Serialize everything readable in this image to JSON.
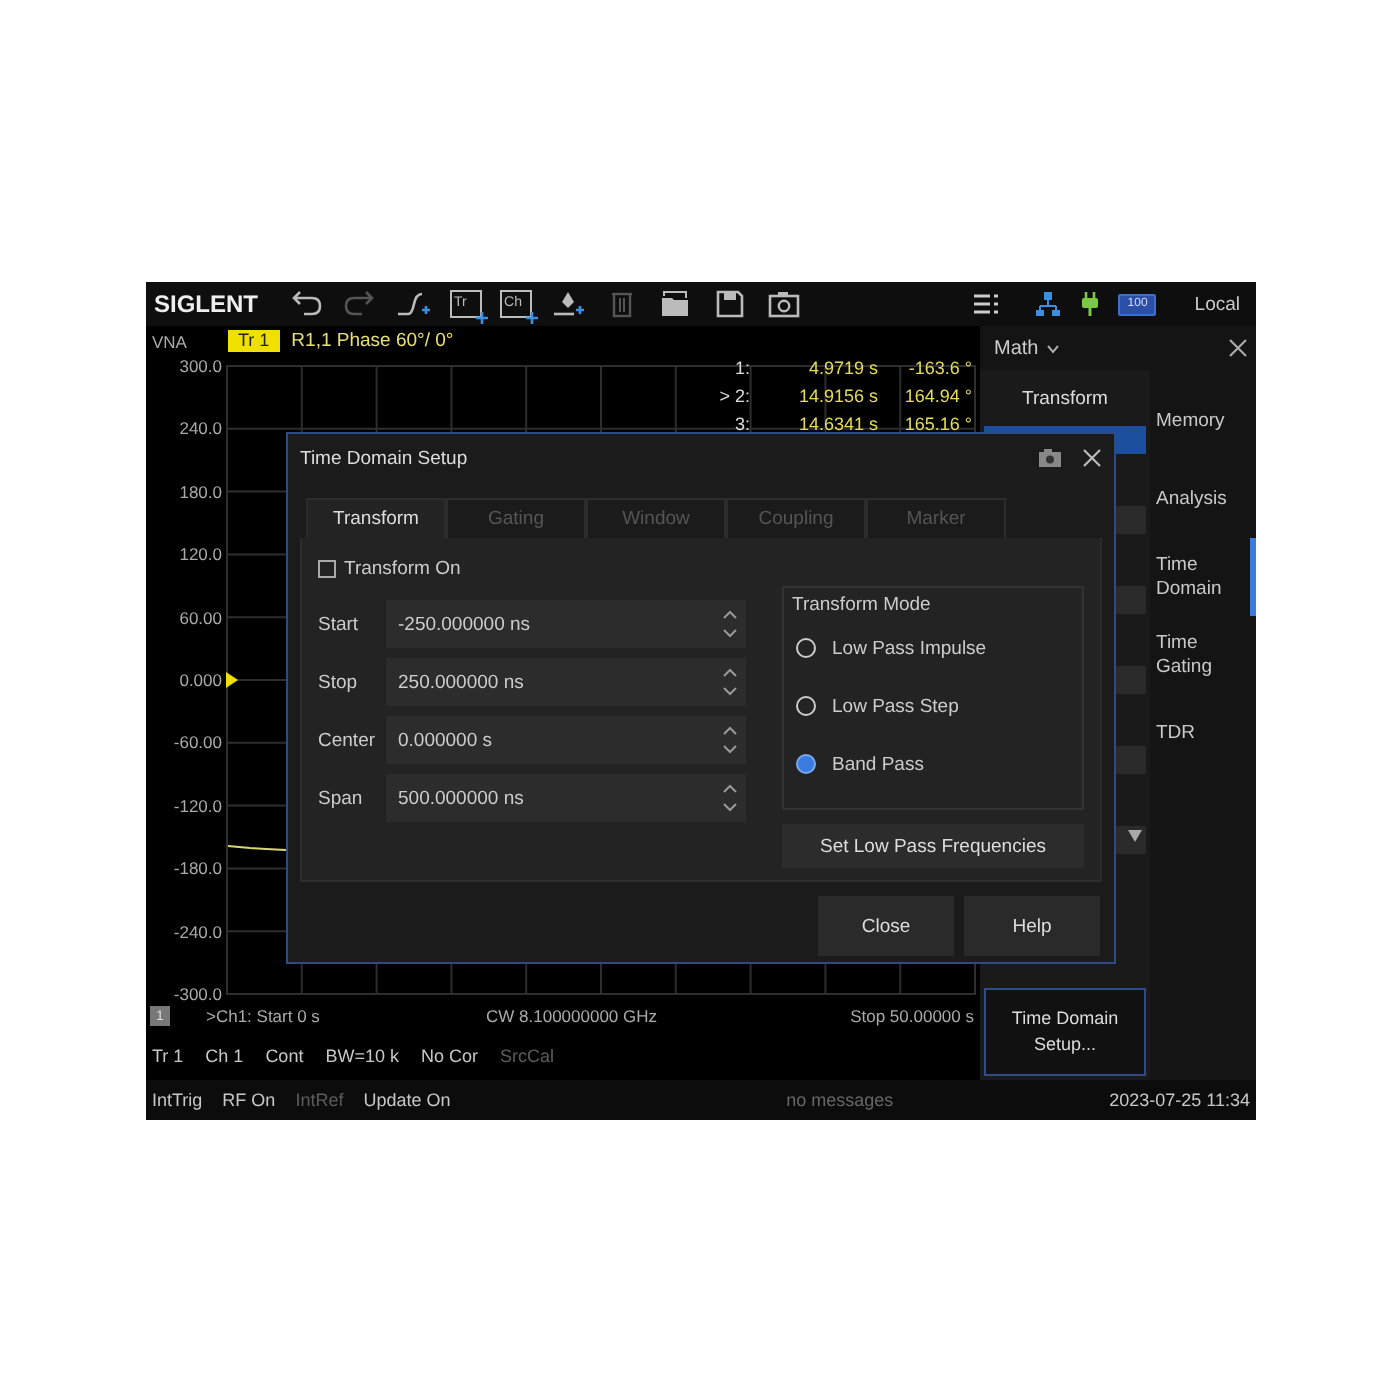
{
  "toolbar": {
    "logo": "SIGLENT",
    "tools": [
      {
        "kind": "undo",
        "disabled": false
      },
      {
        "kind": "redo",
        "disabled": true
      },
      {
        "kind": "step",
        "disabled": false
      },
      {
        "kind": "add_trace",
        "label": "Tr",
        "disabled": false
      },
      {
        "kind": "add_channel",
        "label": "Ch",
        "disabled": false
      },
      {
        "kind": "marker",
        "disabled": false
      },
      {
        "kind": "delete",
        "disabled": true
      },
      {
        "kind": "open",
        "disabled": false
      },
      {
        "kind": "save",
        "disabled": false
      },
      {
        "kind": "camera",
        "disabled": false
      }
    ],
    "battery": "100",
    "mode": "Local"
  },
  "chart": {
    "instrument": "VNA",
    "trace_badge": "Tr 1",
    "trace_label": "R1,1 Phase 60°/ 0°",
    "y_labels": [
      "300.0",
      "240.0",
      "180.0",
      "120.0",
      "60.00",
      "0.000",
      "-60.00",
      "-120.0",
      "-180.0",
      "-240.0",
      "-300.0"
    ],
    "markers": [
      {
        "label": "1:",
        "x": "4.9719 s",
        "y": "-163.6 °"
      },
      {
        "label": "> 2:",
        "x": "14.9156 s",
        "y": "164.94 °"
      },
      {
        "label": "3:",
        "x": "14.6341 s",
        "y": "165.16 °"
      }
    ],
    "channel_badge": "1",
    "start": ">Ch1: Start 0 s",
    "center": "CW 8.100000000 GHz",
    "stop": "Stop 50.00000 s"
  },
  "status_line_1": [
    {
      "text": "Tr 1",
      "dimmed": false
    },
    {
      "text": "Ch 1",
      "dimmed": false
    },
    {
      "text": "Cont",
      "dimmed": false
    },
    {
      "text": "BW=10 k",
      "dimmed": false
    },
    {
      "text": "No Cor",
      "dimmed": false
    },
    {
      "text": "SrcCal",
      "dimmed": true
    }
  ],
  "status_line_2": [
    {
      "text": "IntTrig",
      "dimmed": false
    },
    {
      "text": "RF On",
      "dimmed": false
    },
    {
      "text": "IntRef",
      "dimmed": true
    },
    {
      "text": "Update On",
      "dimmed": false
    }
  ],
  "message": "no messages",
  "datetime": "2023-07-25 11:34",
  "side_panel": {
    "menu": "Math",
    "submenu_title": "Transform",
    "submenu_items": [
      {
        "selected": true
      },
      {
        "selected": false
      },
      {
        "selected": false
      },
      {
        "selected": false
      },
      {
        "selected": false
      },
      {
        "selected": false
      }
    ],
    "categories": [
      {
        "label": "Memory",
        "selected": false
      },
      {
        "label": "Analysis",
        "selected": false
      },
      {
        "label": "Time Domain",
        "selected": true
      },
      {
        "label": "Time Gating",
        "selected": false
      },
      {
        "label": "TDR",
        "selected": false
      }
    ],
    "setup_button": "Time Domain Setup..."
  },
  "dialog": {
    "title": "Time Domain Setup",
    "tabs": [
      {
        "label": "Transform",
        "selected": true
      },
      {
        "label": "Gating",
        "selected": false
      },
      {
        "label": "Window",
        "selected": false
      },
      {
        "label": "Coupling",
        "selected": false
      },
      {
        "label": "Marker",
        "selected": false
      }
    ],
    "transform_on": {
      "label": "Transform On",
      "checked": false
    },
    "fields": [
      {
        "label": "Start",
        "value": "-250.000000 ns"
      },
      {
        "label": "Stop",
        "value": "250.000000 ns"
      },
      {
        "label": "Center",
        "value": "0.000000 s"
      },
      {
        "label": "Span",
        "value": "500.000000 ns"
      }
    ],
    "mode_group": {
      "title": "Transform Mode",
      "options": [
        {
          "label": "Low Pass Impulse",
          "selected": false
        },
        {
          "label": "Low Pass Step",
          "selected": false
        },
        {
          "label": "Band Pass",
          "selected": true
        }
      ]
    },
    "frequencies_button": "Set Low Pass Frequencies",
    "buttons": [
      "Close",
      "Help"
    ]
  }
}
